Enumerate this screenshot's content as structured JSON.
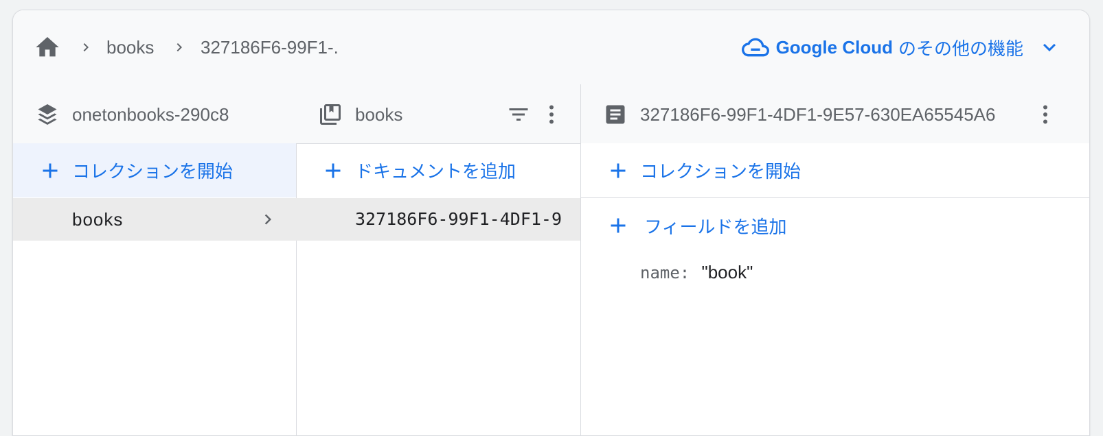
{
  "breadcrumb": {
    "items": [
      "books",
      "327186F6-99F1-."
    ]
  },
  "gcloud": {
    "brand": "Google Cloud",
    "rest": "のその他の機能"
  },
  "columns": {
    "root": {
      "title": "onetonbooks-290c8",
      "action": "コレクションを開始",
      "items": [
        "books"
      ]
    },
    "collection": {
      "title": "books",
      "action": "ドキュメントを追加",
      "items": [
        "327186F6-99F1-4DF1-9"
      ]
    },
    "document": {
      "title": "327186F6-99F1-4DF1-9E57-630EA65545A6",
      "action": "コレクションを開始",
      "add_field": "フィールドを追加",
      "fields": [
        {
          "key": "name",
          "value": "\"book\""
        }
      ]
    }
  },
  "colors": {
    "accent": "#1a73e8",
    "text_muted": "#5f6368",
    "selected_bg": "#ebebeb",
    "action_bg": "#eef3fd"
  }
}
